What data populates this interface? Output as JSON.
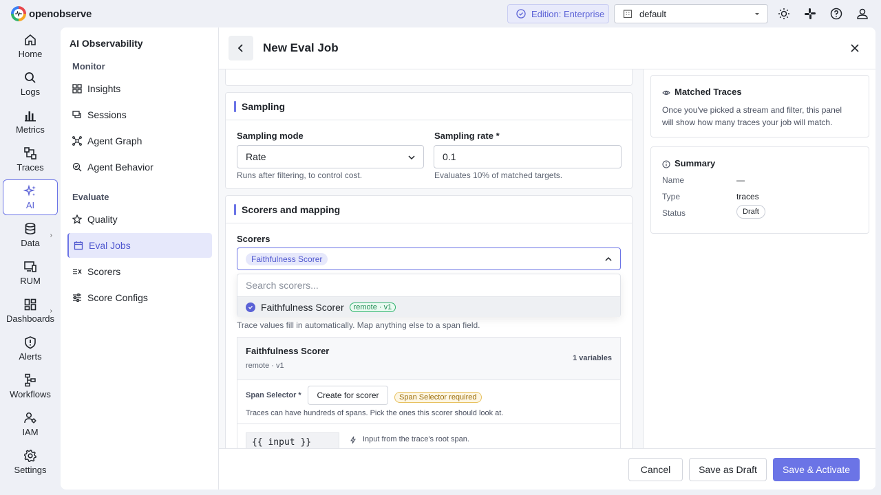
{
  "app": {
    "brand": "openobserve"
  },
  "topbar": {
    "edition_label": "Edition: Enterprise",
    "org_selected": "default",
    "icons": [
      "sun-icon",
      "slack-icon",
      "help-icon",
      "user-icon"
    ]
  },
  "nav": [
    {
      "label": "Home",
      "icon": "home-icon"
    },
    {
      "label": "Logs",
      "icon": "search-icon"
    },
    {
      "label": "Metrics",
      "icon": "bar-chart-icon"
    },
    {
      "label": "Traces",
      "icon": "traces-icon"
    },
    {
      "label": "AI",
      "icon": "sparkle-icon",
      "active": true
    },
    {
      "label": "Data",
      "icon": "database-icon"
    },
    {
      "label": "RUM",
      "icon": "devices-icon"
    },
    {
      "label": "Dashboards",
      "icon": "dashboard-icon"
    },
    {
      "label": "Alerts",
      "icon": "alert-shield-icon"
    },
    {
      "label": "Workflows",
      "icon": "workflow-icon"
    },
    {
      "label": "IAM",
      "icon": "users-icon"
    },
    {
      "label": "Settings",
      "icon": "gear-icon"
    }
  ],
  "subnav": {
    "title": "AI Observability",
    "section_monitor": "Monitor",
    "section_evaluate": "Evaluate",
    "monitor_items": [
      "Insights",
      "Sessions",
      "Agent Graph",
      "Agent Behavior"
    ],
    "evaluate_items": [
      "Quality",
      "Eval Jobs",
      "Scorers",
      "Score Configs"
    ]
  },
  "page": {
    "title": "New Eval Job"
  },
  "sampling": {
    "heading": "Sampling",
    "mode_label": "Sampling mode",
    "mode_value": "Rate",
    "mode_hint": "Runs after filtering, to control cost.",
    "rate_label": "Sampling rate *",
    "rate_value": "0.1",
    "rate_hint": "Evaluates 10% of matched targets."
  },
  "scorers": {
    "heading": "Scorers and mapping",
    "label": "Scorers",
    "selected_chip": "Faithfulness Scorer",
    "search_placeholder": "Search scorers...",
    "option_name": "Faithfulness Scorer",
    "option_tag": "remote · v1",
    "mapping_hint": "Trace values fill in automatically. Map anything else to a span field.",
    "scorer_card": {
      "name": "Faithfulness Scorer",
      "sub": "remote · v1",
      "variables": "1 variables",
      "span_selector_label": "Span Selector *",
      "create_button": "Create for scorer",
      "required_badge": "Span Selector required",
      "span_hint": "Traces can have hundreds of spans. Pick the ones this scorer should look at.",
      "var_name": "{{ input }}",
      "var_hint": "Input from the trace's root span."
    }
  },
  "right": {
    "matched_title": "Matched Traces",
    "matched_text_1": "Once you've picked a stream and filter, this panel",
    "matched_text_2": "will show how many traces your job will match.",
    "summary_title": "Summary",
    "summary": {
      "name_label": "Name",
      "name_value": "—",
      "type_label": "Type",
      "type_value": "traces",
      "status_label": "Status",
      "status_value": "Draft"
    }
  },
  "footer": {
    "cancel": "Cancel",
    "save_draft": "Save as Draft",
    "save_activate": "Save & Activate"
  },
  "colors": {
    "accent": "#6b74e6",
    "accent_text": "#5b62d6"
  }
}
